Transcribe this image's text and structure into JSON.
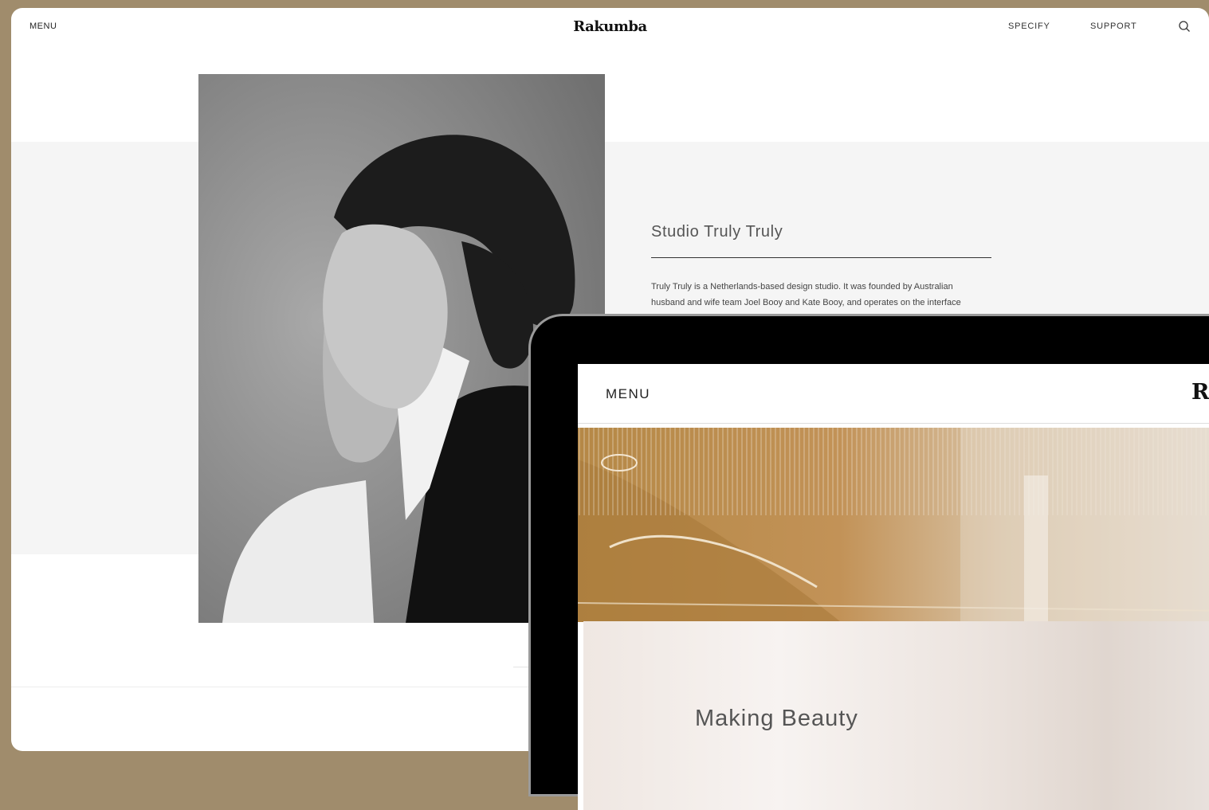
{
  "nav": {
    "menu_label": "MENU",
    "logo": "Rakumba",
    "links": [
      "SPECIFY",
      "SUPPORT"
    ]
  },
  "studio": {
    "title": "Studio Truly Truly",
    "body": "Truly Truly is a Netherlands-based design studio. It was founded by Australian husband and wife team Joel Booy and Kate Booy, and operates on the interface between industry and art. The duo runs a"
  },
  "tablet": {
    "menu_label": "MENU",
    "logo": "Ra",
    "card_title": "Making Beauty"
  },
  "colors": {
    "background": "#a08c6c",
    "band": "#f5f5f5"
  },
  "icons": [
    "search-icon"
  ]
}
